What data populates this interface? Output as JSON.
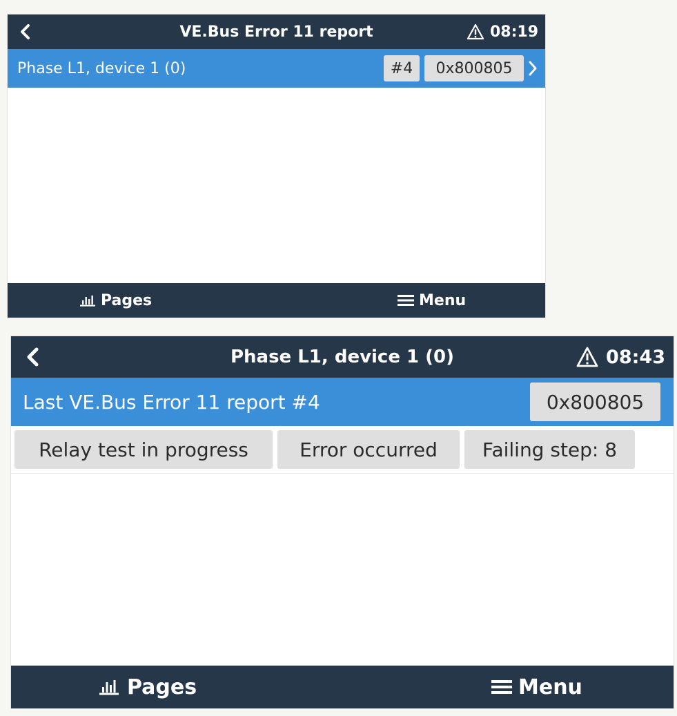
{
  "screens": [
    {
      "title": "VE.Bus Error 11 report",
      "time": "08:19",
      "row": {
        "label": "Phase L1, device 1 (0)",
        "chips": [
          "#4",
          "0x800805"
        ]
      },
      "nav": {
        "pages": "Pages",
        "menu": "Menu"
      }
    },
    {
      "title": "Phase L1, device 1 (0)",
      "time": "08:43",
      "row": {
        "label": "Last VE.Bus Error 11 report #4",
        "chips": [
          "0x800805"
        ]
      },
      "status_chips": [
        "Relay test in progress",
        "Error occurred",
        "Failing step: 8"
      ],
      "nav": {
        "pages": "Pages",
        "menu": "Menu"
      }
    }
  ],
  "icons": {
    "back": "chevron-left-icon",
    "warning": "warning-triangle-icon",
    "forward": "chevron-right-icon",
    "pages": "bar-chart-icon",
    "menu": "hamburger-menu-icon"
  },
  "colors": {
    "header": "#27374a",
    "highlight_row": "#3b8fd9",
    "chip": "#dfdfdf",
    "background": "#ffffff"
  }
}
